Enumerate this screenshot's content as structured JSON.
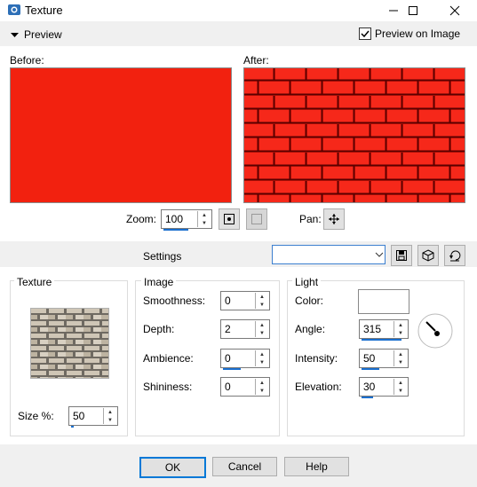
{
  "window": {
    "title": "Texture"
  },
  "toolbar": {
    "preview_label": "Preview",
    "preview_on_image_label": "Preview on Image",
    "preview_on_image_checked": true
  },
  "previews": {
    "before_label": "Before:",
    "after_label": "After:",
    "preview_color": "#f2210f"
  },
  "zoom": {
    "label": "Zoom:",
    "value": "100",
    "pan_label": "Pan:"
  },
  "settings": {
    "label": "Settings",
    "value": ""
  },
  "texture": {
    "title": "Texture",
    "size_label": "Size %:",
    "size_value": "50"
  },
  "image": {
    "title": "Image",
    "smoothness_label": "Smoothness:",
    "smoothness_value": "0",
    "depth_label": "Depth:",
    "depth_value": "2",
    "ambience_label": "Ambience:",
    "ambience_value": "0",
    "shininess_label": "Shininess:",
    "shininess_value": "0"
  },
  "light": {
    "title": "Light",
    "color_label": "Color:",
    "color_value": "#ffffff",
    "angle_label": "Angle:",
    "angle_value": "315",
    "intensity_label": "Intensity:",
    "intensity_value": "50",
    "elevation_label": "Elevation:",
    "elevation_value": "30"
  },
  "buttons": {
    "ok": "OK",
    "cancel": "Cancel",
    "help": "Help"
  }
}
